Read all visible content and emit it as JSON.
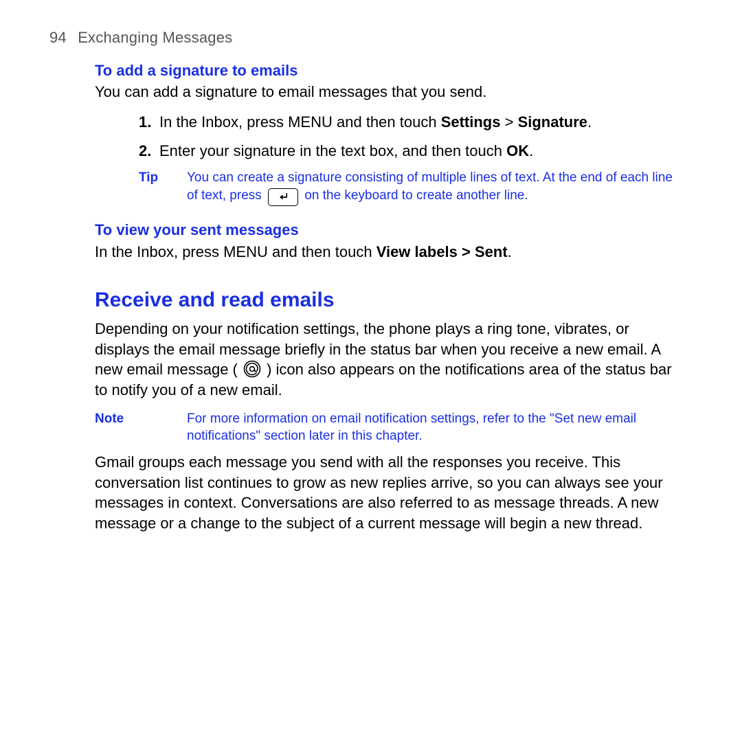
{
  "header": {
    "page_number": "94",
    "chapter_title": "Exchanging Messages"
  },
  "sec_signature": {
    "heading": "To add a signature to emails",
    "intro": "You can add a signature to email messages that you send.",
    "steps": [
      {
        "n": "1.",
        "pre": "In the Inbox, press MENU and then touch ",
        "b1": "Settings",
        "mid": " > ",
        "b2": "Signature",
        "post": "."
      },
      {
        "n": "2.",
        "pre": "Enter your signature in the text box, and then touch ",
        "b1": "OK",
        "post": "."
      }
    ],
    "tip": {
      "label": "Tip",
      "line1": "You can create a signature consisting of multiple lines of text. At the end of each line of text, press ",
      "line2": " on the keyboard to create another line."
    }
  },
  "sec_view_sent": {
    "heading": "To view your sent messages",
    "pre": "In the Inbox, press MENU and then touch ",
    "b1": "View labels > Sent",
    "post": "."
  },
  "sec_receive": {
    "heading": "Receive and read emails",
    "p1a": "Depending on your notification settings, the phone plays a ring tone, vibrates, or displays the email message briefly in the status bar when you receive a new email. A new email message ( ",
    "p1b": " ) icon also appears on the notifications area of the status bar to notify you of a new email.",
    "note": {
      "label": "Note",
      "body": "For more information on email notification settings, refer to the \"Set new email notifications\" section later in this chapter."
    },
    "p2": "Gmail groups each message you send with all the responses you receive. This conversation list continues to grow as new replies arrive, so you can always see your messages in context. Conversations are also referred to as message threads. A new message or a change to the subject of a current message will begin a new thread."
  }
}
